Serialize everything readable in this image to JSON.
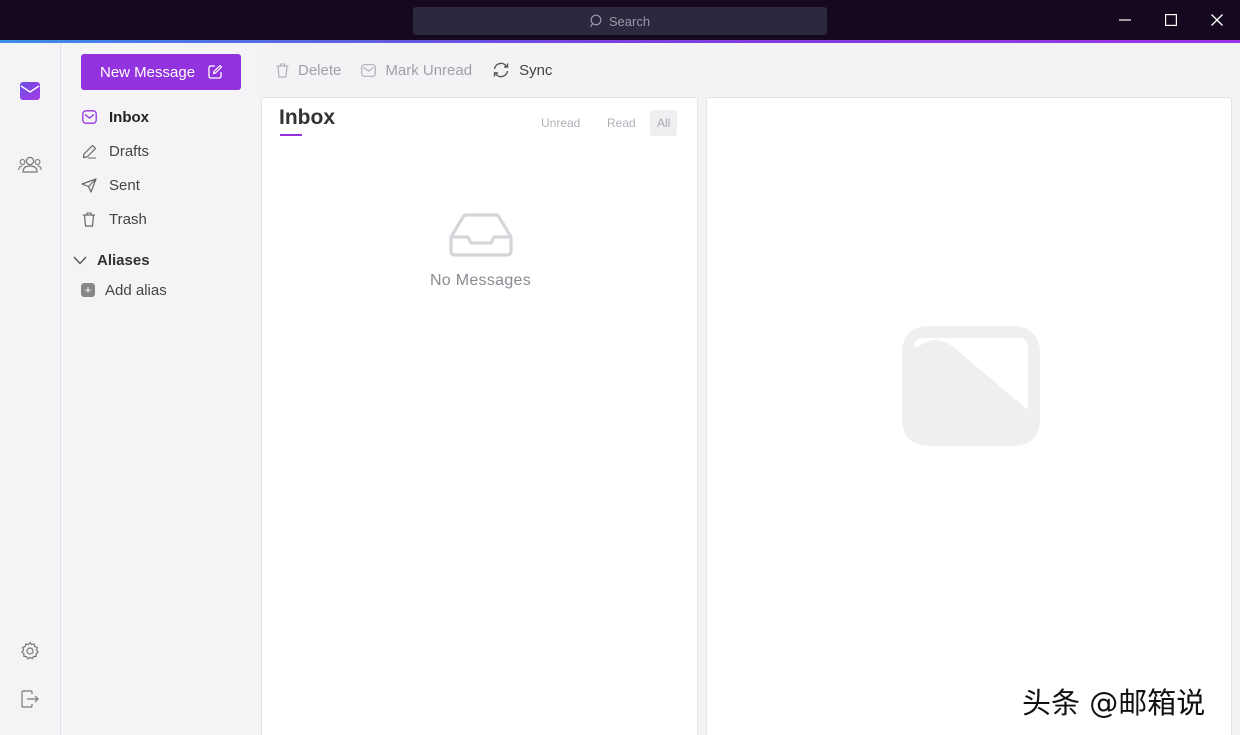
{
  "titlebar": {
    "search_placeholder": "Search",
    "controls": [
      "minimize-icon",
      "maximize-icon",
      "close-icon"
    ]
  },
  "rail": {
    "items": [
      {
        "icon": "mail-icon",
        "active": true
      },
      {
        "icon": "contacts-icon",
        "active": false
      }
    ],
    "bottom_items": [
      "settings-icon",
      "logout-icon"
    ]
  },
  "folders": {
    "new_message_label": "New Message",
    "items": [
      {
        "label": "Inbox",
        "icon": "inbox-icon",
        "active": true
      },
      {
        "label": "Drafts",
        "icon": "pencil-icon",
        "active": false
      },
      {
        "label": "Sent",
        "icon": "send-icon",
        "active": false
      },
      {
        "label": "Trash",
        "icon": "trash-icon",
        "active": false
      }
    ],
    "aliases_label": "Aliases",
    "add_alias_label": "Add alias"
  },
  "toolbar": {
    "delete_label": "Delete",
    "mark_unread_label": "Mark Unread",
    "sync_label": "Sync"
  },
  "message_list": {
    "title": "Inbox",
    "filters": [
      {
        "label": "Unread",
        "active": false
      },
      {
        "label": "Read",
        "active": false
      },
      {
        "label": "All",
        "active": true
      }
    ],
    "empty_text": "No Messages"
  },
  "watermark": "头条 @邮箱说",
  "colors": {
    "accent": "#9333e0",
    "titlebar_bg": "#150920",
    "search_bg": "#2d2740"
  }
}
